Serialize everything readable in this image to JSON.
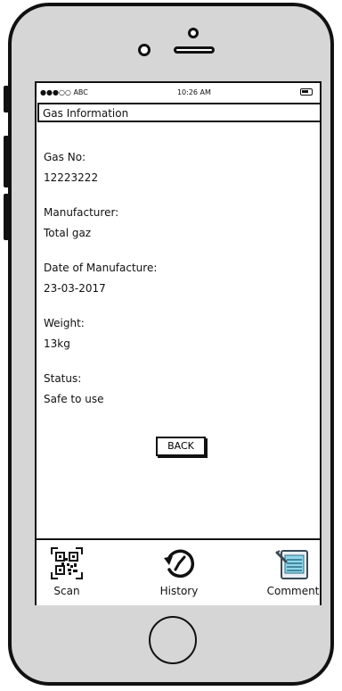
{
  "status_bar": {
    "carrier": "●●●○○ ABC",
    "time": "10:26 AM"
  },
  "header": {
    "title": "Gas Information"
  },
  "fields": [
    {
      "label": "Gas No:",
      "value": "12223222"
    },
    {
      "label": "Manufacturer:",
      "value": "Total gaz"
    },
    {
      "label": "Date of Manufacture:",
      "value": "23-03-2017"
    },
    {
      "label": "Weight:",
      "value": "13kg"
    },
    {
      "label": "Status:",
      "value": "Safe to use"
    }
  ],
  "back_button": {
    "label": "BACK"
  },
  "tabbar": {
    "items": [
      {
        "label": "Scan",
        "icon": "qr-code-icon"
      },
      {
        "label": "History",
        "icon": "history-icon"
      },
      {
        "label": "Comment",
        "icon": "comment-icon"
      }
    ]
  }
}
